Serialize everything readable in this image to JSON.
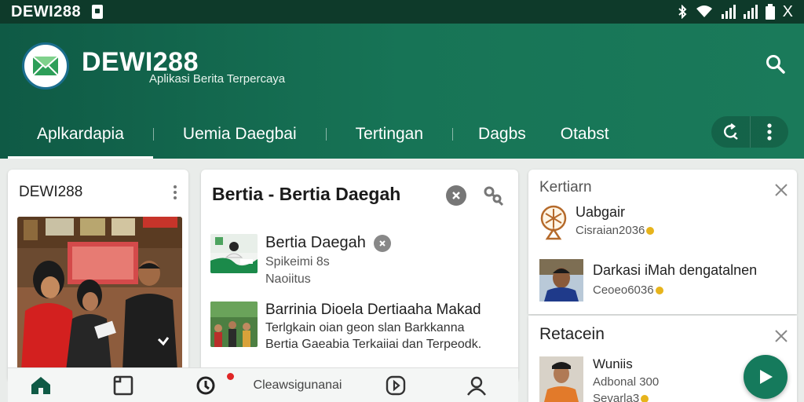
{
  "status_bar": {
    "title": "DEWI288",
    "close_glyph": "X",
    "icons": [
      "document-icon",
      "bluetooth-icon",
      "wifi-icon",
      "signal-icon",
      "battery-icon",
      "close-icon"
    ]
  },
  "header": {
    "brand": "DEWI288",
    "tagline": "Aplikasi Berita Terpercaya",
    "colors": {
      "header": "#177456",
      "status_bar": "#0e3a2a",
      "accent": "#157a5c"
    }
  },
  "tabs": [
    {
      "label": "Aplkardapia",
      "active": true
    },
    {
      "label": "Uemia Daegbai",
      "active": false
    },
    {
      "label": "Tertingan",
      "active": false
    },
    {
      "label": "Dagbs",
      "active": false
    },
    {
      "label": "Otabst",
      "active": false
    }
  ],
  "card1": {
    "title": "DEWI288"
  },
  "card2": {
    "title": "Bertia - Bertia Daegah",
    "items": [
      {
        "title": "Bertia Daegah",
        "line2": "Spikeimi 8s",
        "line3": "Naoiitus"
      },
      {
        "title": "Barrinia Dioela Dertiaaha Makad",
        "line2": "Terlgkain oian geon slan Barkkanna",
        "line3": "Bertia Gaeabia Terkaiiai dan Terpeodk."
      }
    ]
  },
  "card3": {
    "title": "Kertiarn",
    "items": [
      {
        "title": "Uabgair",
        "subtitle": "Cisraian2036"
      },
      {
        "title": "Darkasi iMah dengatalnen",
        "subtitle": "Ceoeo6036"
      }
    ]
  },
  "card4": {
    "title": "Retacein",
    "items": [
      {
        "title": "Wuniis",
        "subtitle": "Adbonal 300",
        "subtitle2": "Sevarla3"
      }
    ]
  },
  "bottom_nav": {
    "items": [
      {
        "icon": "home-icon",
        "active": true
      },
      {
        "icon": "tablet-icon"
      },
      {
        "icon": "notification-icon",
        "badge": true
      },
      {
        "label": "Cleawsigunanai"
      },
      {
        "icon": "play-circle-icon"
      },
      {
        "icon": "profile-icon"
      }
    ]
  },
  "fab": {
    "icon": "play-icon"
  }
}
